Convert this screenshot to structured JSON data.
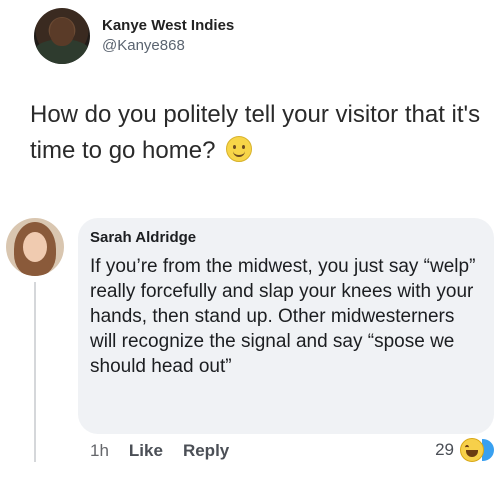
{
  "tweet": {
    "author_name": "Kanye West Indies",
    "author_handle": "@Kanye868",
    "text": "How do you politely tell your visitor that it's time to go home?"
  },
  "comment": {
    "author_name": "Sarah Aldridge",
    "text": "If you’re from the midwest, you just say “welp” really forcefully and slap your knees with your hands, then stand up. Other midwesterners will recognize the signal and say “spose we should head out”",
    "time": "1h",
    "like_label": "Like",
    "reply_label": "Reply",
    "reaction_count": "29"
  },
  "icons": {
    "tweet_emoji": "slightly-smiling-face-icon",
    "reaction_icons": [
      "laugh-reaction-icon",
      "like-reaction-icon"
    ]
  }
}
